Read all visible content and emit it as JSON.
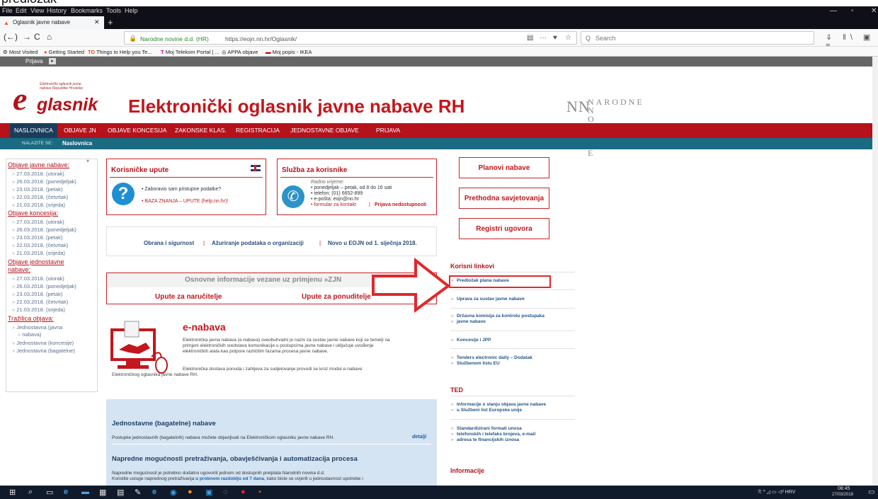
{
  "top_caption": "predložak",
  "menu": {
    "items": [
      "File",
      "Edit",
      "View",
      "History",
      "Bookmarks",
      "Tools",
      "Help"
    ],
    "win_min": "—",
    "win_max": "▫",
    "win_close": "✕"
  },
  "tab": {
    "title": "Oglasnik javne nabave",
    "close": "✕",
    "new": "+"
  },
  "nav": {
    "back": "(←)",
    "forward": "→",
    "reload": "C",
    "home": "⌂",
    "info_icon": "ⓘ",
    "lock_icon": "🔒",
    "org": "Narodne novine d.d. (HR)",
    "url": "https://eojn.nn.hr/Oglasnik/",
    "reader": "▤",
    "more": "···",
    "pocket": "♥",
    "star": "☆",
    "search_icon": "Q",
    "search_placeholder": "Search",
    "toolbar_icons": "⇓ ‖\\ ▣ ≡"
  },
  "bookmarks": [
    "Most Visited",
    "Getting Started",
    "Things to Help you Te...",
    "Moj Telekom Portal | ...",
    "APPA objave",
    "Moj popis - IKEA"
  ],
  "login_bar": {
    "label": "Prijava",
    "icon": "▸"
  },
  "banner": {
    "logo_small": "Elektronički oglasnik javne nabave Republike Hrvatske",
    "logo_e": "e",
    "logo_text": "glasnik",
    "title": "Elektronički oglasnik javne nabave RH",
    "nn_logo_big": "NN",
    "nn_logo_line1": "NARODNE",
    "nn_logo_line2": "N O V I N E"
  },
  "main_nav": [
    "NASLOVNICA",
    "OBJAVE JN",
    "OBJAVE KONCESIJA",
    "ZAKONSKE KLAS.",
    "REGISTRACIJA",
    "JEDNOSTAVNE OBJAVE",
    "PRIJAVA"
  ],
  "crumb": {
    "label": "NALAZITE SE:",
    "value": "Naslovnica"
  },
  "left": {
    "dropdown_icon": "▾",
    "sec1_title": "Objave javne nabave:",
    "sec1": [
      "27.03.2018. (utorak)",
      "26.03.2018. (ponedjeljak)",
      "23.03.2018. (petak)",
      "22.03.2018. (četvrtak)",
      "21.03.2018. (srijeda)"
    ],
    "sec2_title": "Objave koncesija:",
    "sec2": [
      "27.03.2018. (utorak)",
      "26.03.2018. (ponedjeljak)",
      "23.03.2018. (petak)",
      "22.03.2018. (četvrtak)",
      "21.03.2018. (srijeda)"
    ],
    "sec3_title_1": "Objave jednostavne",
    "sec3_title_2": "nabave:",
    "sec3": [
      "27.03.2018. (utorak)",
      "26.03.2018. (ponedjeljak)",
      "23.03.2018. (petak)",
      "22.03.2018. (četvrtak)",
      "21.03.2018. (srijeda)"
    ],
    "sec4_title": "Tražilica objava:",
    "sec4": [
      "Jednostavna (javna",
      "nabava)",
      "Jednostavna (koncesije)",
      "Jednostavna (bagatelne)"
    ]
  },
  "korisnicke": {
    "title": "Korisničke upute",
    "help_glyph": "?",
    "line1": "• Zaboravio sam pristupne podatke?",
    "line2": "• BAZA ZNANJA – UPUTE (help.nn.hr)!"
  },
  "sluzba": {
    "title": "Služba za korisnike",
    "phone_glyph": "✆",
    "l1": "Radno vrijeme:",
    "l2": "• ponedjeljak – petak, od 8 do 16 sati",
    "l3": "• telefon: (01) 6652-899",
    "l4": "• e-pošta: eojn@nn.hr",
    "l5a": "• formular za kontakt",
    "l5sep": "|",
    "l5b": "Prijava nedostupnosti"
  },
  "links_row": {
    "a": "Obrana i sigurnost",
    "b": "Ažuriranje podataka o organizaciji",
    "c": "Novo u EOJN od 1. siječnja 2018.",
    "sep": "|"
  },
  "info": {
    "head": "Osnovne informacije vezane uz primjenu »ZJN",
    "a": "Upute za naručitelje",
    "b": "Upute za ponuditelje"
  },
  "enabava": {
    "title": "e-nabava",
    "p1": [
      "Elektronička javna nabava (e-nabava) sveobuhvatni je naziv za sustav javne nabave koji se temelji na",
      "primjeni elektroničkih sredstava komunikacije u postupcima javne nabave i uključuje uvođenje",
      "elektroničkih alata kao potpore različitim fazama procesa javne nabave."
    ],
    "p2a": "Elektronička dostava ponuda i zahtjeva za sudjelovanje provodi se kroz modul e-nabave",
    "p2b": "Elektroničkog oglasnika javne nabave RH."
  },
  "blue": {
    "h1": "Jednostavne (bagatelne) nabave",
    "p1": "Postupke jednostavnih (bagatelnih) nabava možete objavljivati na Elektroničkom oglasniku javne nabave RH.",
    "detail": "detalji",
    "h2": "Napredne mogućnosti pretraživanja, obavješćivanja i automatizacija procesa",
    "p2": "Napredne mogućnosti je potrebno dodatno ugovoriti jednom od dostupnih pretplata Narodnih novina d.d.",
    "p3a": "Koristite usluge naprednog pretraživanja ",
    "p3b": "u probnom razdoblju od 7 dana",
    "p3c": ", kako biste se uvjerili u jednostavnost upotrebe i"
  },
  "right": {
    "btn1": "Planovi nabave",
    "btn2": "Prethodna savjetovanja",
    "btn3": "Registri ugovora",
    "sec_links": "Korisni linkovi",
    "links": [
      [
        "Predložak plana nabave"
      ],
      [
        "Uprava za sustav javne nabave"
      ],
      [
        "Državna komisija za kontrolu postupaka",
        "javne nabave"
      ],
      [
        "Koncesije i JPP"
      ],
      [
        "Tenders electronic daily – Dodatak",
        "Službenom listu EU"
      ]
    ],
    "sec_ted": "TED",
    "ted": [
      [
        "Informacije o slanju objava javne nabave",
        "u Službeni list Europske unije"
      ],
      [
        "Standardizirani formati unosa",
        "telefonskih i telefaks brojeva, e-mail",
        "adresa te financijskih iznosa"
      ]
    ],
    "sec_info": "Informacije"
  },
  "taskbar": {
    "icons": [
      "⊞",
      "⌕",
      "▭",
      "e",
      "▬",
      "▦",
      "▤",
      "✎",
      "e",
      "◉",
      "●",
      "▣",
      "◌",
      "●",
      "▪"
    ],
    "tray": "ℛ  ^  ◿  ▭  ◁ᵈ  HRV",
    "time": "08:45",
    "date": "27/03/2018",
    "notif": "▭"
  }
}
